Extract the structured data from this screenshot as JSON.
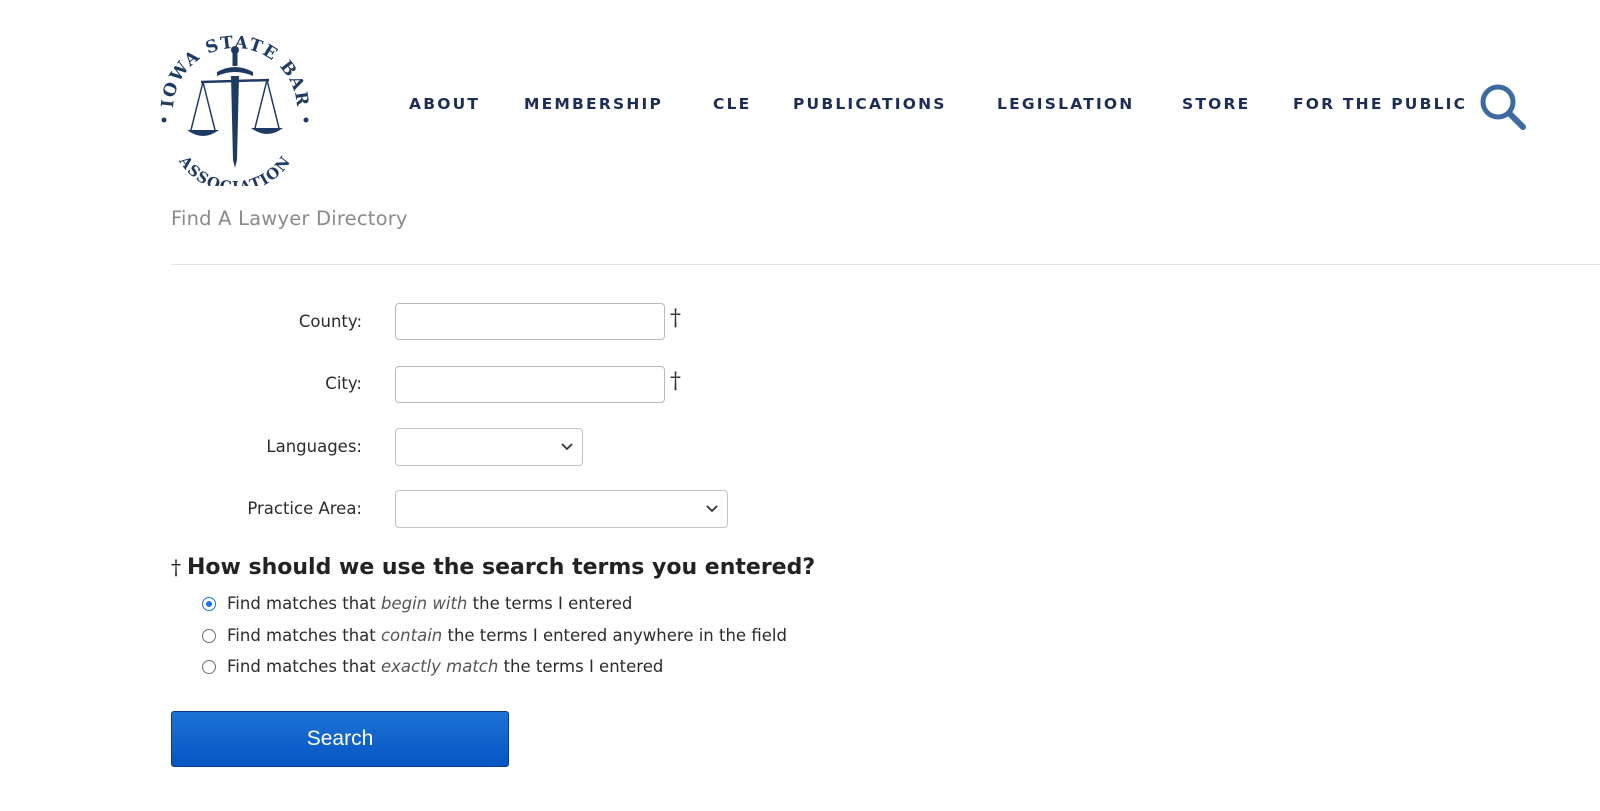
{
  "logo": {
    "top_text": "IOWA STATE BAR",
    "bottom_text": "ASSOCIATION",
    "color": "#1f3a63"
  },
  "nav": {
    "items": [
      "ABOUT",
      "MEMBERSHIP",
      "CLE",
      "PUBLICATIONS",
      "LEGISLATION",
      "STORE",
      "FOR THE PUBLIC"
    ],
    "color": "#1c2e55"
  },
  "header": {
    "search_icon": "search-icon"
  },
  "page": {
    "title": "Find A Lawyer Directory"
  },
  "form": {
    "county": {
      "label": "County:",
      "value": "",
      "placeholder": ""
    },
    "city": {
      "label": "City:",
      "value": "",
      "placeholder": ""
    },
    "languages": {
      "label": "Languages:",
      "selected": ""
    },
    "practice_area": {
      "label": "Practice Area:",
      "selected": ""
    },
    "dagger": "†"
  },
  "match": {
    "dagger": "†",
    "question": "How should we use the search terms you entered?",
    "options": [
      {
        "prefix": "Find matches that ",
        "emphasis": "begin with",
        "suffix": " the terms I entered",
        "checked": true
      },
      {
        "prefix": "Find matches that ",
        "emphasis": "contain",
        "suffix": " the terms I entered anywhere in the field",
        "checked": false
      },
      {
        "prefix": "Find matches that ",
        "emphasis": "exactly match",
        "suffix": " the terms I entered",
        "checked": false
      }
    ]
  },
  "search_button": {
    "label": "Search",
    "color": "#0a5fcf"
  }
}
